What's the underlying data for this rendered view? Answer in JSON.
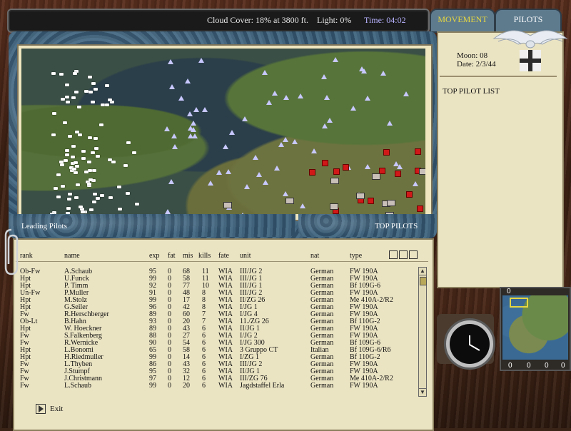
{
  "status_bar": {
    "cloud_cover": "Cloud Cover: 18% at 3800 ft.",
    "light": "Light:  0%",
    "time": "Time: 04:02"
  },
  "tabs": {
    "movement": "MOVEMENT",
    "pilots": "PILOTS"
  },
  "info": {
    "moon": "Moon:  08",
    "date": "Date:  2/3/44",
    "top_pilot_list": "TOP PILOT LIST"
  },
  "panels": {
    "leading_pilots": "Leading Pilots",
    "top_pilots": "TOP PILOTS"
  },
  "table": {
    "headers": {
      "rank": "rank",
      "name": "name",
      "exp": "exp",
      "fat": "fat",
      "mis": "mis",
      "kills": "kills",
      "fate": "fate",
      "unit": "unit",
      "nat": "nat",
      "type": "type"
    },
    "rows": [
      {
        "rank": "Ob-Fw",
        "name": "A.Schaub",
        "exp": "95",
        "fat": "0",
        "mis": "68",
        "kills": "11",
        "fate": "WIA",
        "unit": "III/JG 2",
        "nat": "German",
        "type": "FW 190A"
      },
      {
        "rank": "Hpt",
        "name": "U.Funck",
        "exp": "99",
        "fat": "0",
        "mis": "58",
        "kills": "11",
        "fate": "WIA",
        "unit": "III/JG 1",
        "nat": "German",
        "type": "FW 190A"
      },
      {
        "rank": "Hpt",
        "name": "P. Timm",
        "exp": "92",
        "fat": "0",
        "mis": "77",
        "kills": "10",
        "fate": "WIA",
        "unit": "III/JG 1",
        "nat": "German",
        "type": "Bf 109G-6"
      },
      {
        "rank": "Un-Fw",
        "name": "P.Muller",
        "exp": "91",
        "fat": "0",
        "mis": "48",
        "kills": "8",
        "fate": "WIA",
        "unit": "III/JG 2",
        "nat": "German",
        "type": "FW 190A"
      },
      {
        "rank": "Hpt",
        "name": "M.Stolz",
        "exp": "99",
        "fat": "0",
        "mis": "17",
        "kills": "8",
        "fate": "WIA",
        "unit": "II/ZG 26",
        "nat": "German",
        "type": "Me 410A-2/R2"
      },
      {
        "rank": "Hpt",
        "name": "G.Seiler",
        "exp": "96",
        "fat": "0",
        "mis": "42",
        "kills": "8",
        "fate": "WIA",
        "unit": "I/JG 1",
        "nat": "German",
        "type": "FW 190A"
      },
      {
        "rank": "Fw",
        "name": "R.Herschberger",
        "exp": "89",
        "fat": "0",
        "mis": "60",
        "kills": "7",
        "fate": "WIA",
        "unit": "I/JG 4",
        "nat": "German",
        "type": "FW 190A"
      },
      {
        "rank": "Ob-Lt",
        "name": "B.Hahn",
        "exp": "93",
        "fat": "0",
        "mis": "20",
        "kills": "7",
        "fate": "WIA",
        "unit": "11./ZG 26",
        "nat": "German",
        "type": "Bf 110G-2"
      },
      {
        "rank": "Hpt",
        "name": "W. Hoeckner",
        "exp": "89",
        "fat": "0",
        "mis": "43",
        "kills": "6",
        "fate": "WIA",
        "unit": "II/JG 1",
        "nat": "German",
        "type": "FW 190A"
      },
      {
        "rank": "Fw",
        "name": "S.Falkenberg",
        "exp": "88",
        "fat": "0",
        "mis": "27",
        "kills": "6",
        "fate": "WIA",
        "unit": "I/JG 2",
        "nat": "German",
        "type": "FW 190A"
      },
      {
        "rank": "Fw",
        "name": "R.Wernicke",
        "exp": "90",
        "fat": "0",
        "mis": "54",
        "kills": "6",
        "fate": "WIA",
        "unit": "I/JG 300",
        "nat": "German",
        "type": "Bf 109G-6"
      },
      {
        "rank": "Hpt",
        "name": "L.Bonomi",
        "exp": "65",
        "fat": "0",
        "mis": "58",
        "kills": "6",
        "fate": "WIA",
        "unit": "3 Gruppo CT",
        "nat": "Italian",
        "type": "Bf 109G-6/R6"
      },
      {
        "rank": "Hpt",
        "name": "H.Riedmuller",
        "exp": "99",
        "fat": "0",
        "mis": "14",
        "kills": "6",
        "fate": "WIA",
        "unit": "I/ZG 1",
        "nat": "German",
        "type": "Bf 110G-2"
      },
      {
        "rank": "Fw",
        "name": "L.Thyben",
        "exp": "86",
        "fat": "0",
        "mis": "43",
        "kills": "6",
        "fate": "WIA",
        "unit": "III/JG 2",
        "nat": "German",
        "type": "FW 190A"
      },
      {
        "rank": "Fw",
        "name": "J.Stumpf",
        "exp": "95",
        "fat": "0",
        "mis": "32",
        "kills": "6",
        "fate": "WIA",
        "unit": "II/JG 1",
        "nat": "German",
        "type": "FW 190A"
      },
      {
        "rank": "Fw",
        "name": "J.Christmann",
        "exp": "97",
        "fat": "0",
        "mis": "12",
        "kills": "6",
        "fate": "WIA",
        "unit": "III/ZG 76",
        "nat": "German",
        "type": "Me 410A-2/R2"
      },
      {
        "rank": "Fw",
        "name": "L.Schaub",
        "exp": "99",
        "fat": "0",
        "mis": "20",
        "kills": "6",
        "fate": "WIA",
        "unit": "Jagdstaffel Erla",
        "nat": "German",
        "type": "FW 190A"
      }
    ]
  },
  "exit_label": "Exit",
  "minimap": {
    "top_left": "0",
    "bottom": [
      "0",
      "0",
      "0",
      "0"
    ]
  },
  "icons": {
    "emblem": "eagle-cross-icon",
    "clock": "clock-icon",
    "paperclip": "paperclip-icon",
    "exit": "exit-arrow-icon"
  }
}
